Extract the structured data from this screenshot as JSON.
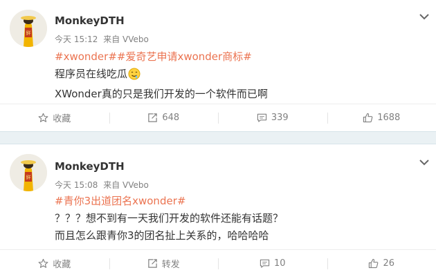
{
  "posts": [
    {
      "username": "MonkeyDTH",
      "time": "今天 15:12",
      "source": "来自 VVebo",
      "hashtags": "#xwonder##爱奇艺申请xwonder商标#",
      "line1": "程序员在线吃瓜",
      "emoji_icon": "drooling-face-emoji",
      "line2": "XWonder真的只是我们开发的一个软件而已啊",
      "actions": {
        "favorite": "收藏",
        "repost": "648",
        "comment": "339",
        "like": "1688"
      }
    },
    {
      "username": "MonkeyDTH",
      "time": "今天 15:08",
      "source": "来自 VVebo",
      "hashtags": "#青你3出道团名xwonder#",
      "line1": "？？？想不到有一天我们开发的软件还能有话题？",
      "line2": "而且怎么跟青你3的团名扯上关系的，哈哈哈哈",
      "actions": {
        "favorite": "收藏",
        "repost": "转发",
        "comment": "10",
        "like": "26"
      }
    }
  ],
  "colors": {
    "hashtag": "#eb7350",
    "separator": "#eaf1f4",
    "meta": "#808080"
  }
}
